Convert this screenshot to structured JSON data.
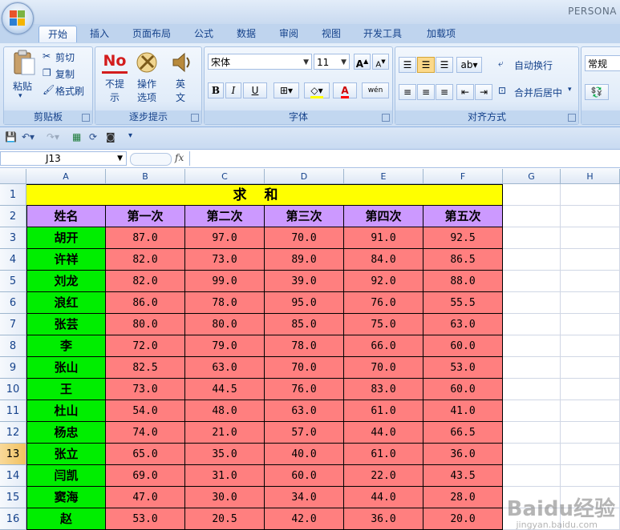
{
  "app": {
    "title": "PERSONA"
  },
  "tabs": [
    {
      "label": "开始",
      "active": true
    },
    {
      "label": "插入"
    },
    {
      "label": "页面布局"
    },
    {
      "label": "公式"
    },
    {
      "label": "数据"
    },
    {
      "label": "审阅"
    },
    {
      "label": "视图"
    },
    {
      "label": "开发工具"
    },
    {
      "label": "加载项"
    }
  ],
  "ribbon": {
    "clipboard": {
      "label": "剪贴板",
      "paste": "粘贴",
      "cut": "剪切",
      "copy": "复制",
      "format_painter": "格式刷"
    },
    "sync": {
      "label": "逐步提示",
      "no_prompt": "不提示",
      "operation_options": "操作选项",
      "english": "英文",
      "no_icon_text": "No"
    },
    "font": {
      "label": "字体",
      "font_name": "宋体",
      "font_size": "11",
      "bold": "B",
      "italic": "I",
      "underline": "U",
      "wen": "wén",
      "font_color_letter": "A"
    },
    "alignment": {
      "label": "对齐方式",
      "wrap_text": "自动换行",
      "merge_center": "合并后居中"
    },
    "number": {
      "format": "常规"
    }
  },
  "formula_bar": {
    "name_box": "J13",
    "fx": "fx",
    "formula": ""
  },
  "columns": [
    "A",
    "B",
    "C",
    "D",
    "E",
    "F",
    "G",
    "H"
  ],
  "rows": [
    "1",
    "2",
    "3",
    "4",
    "5",
    "6",
    "7",
    "8",
    "9",
    "10",
    "11",
    "12",
    "13",
    "14",
    "15",
    "16"
  ],
  "selected_row": "13",
  "sheet": {
    "title": "求和",
    "headers": [
      "姓名",
      "第一次",
      "第二次",
      "第三次",
      "第四次",
      "第五次"
    ],
    "data": [
      [
        "胡开",
        "87.0",
        "97.0",
        "70.0",
        "91.0",
        "92.5"
      ],
      [
        "许祥",
        "82.0",
        "73.0",
        "89.0",
        "84.0",
        "86.5"
      ],
      [
        "刘龙",
        "82.0",
        "99.0",
        "39.0",
        "92.0",
        "88.0"
      ],
      [
        "浪红",
        "86.0",
        "78.0",
        "95.0",
        "76.0",
        "55.5"
      ],
      [
        "张芸",
        "80.0",
        "80.0",
        "85.0",
        "75.0",
        "63.0"
      ],
      [
        "李",
        "72.0",
        "79.0",
        "78.0",
        "66.0",
        "60.0"
      ],
      [
        "张山",
        "82.5",
        "63.0",
        "70.0",
        "70.0",
        "53.0"
      ],
      [
        "王",
        "73.0",
        "44.5",
        "76.0",
        "83.0",
        "60.0"
      ],
      [
        "杜山",
        "54.0",
        "48.0",
        "63.0",
        "61.0",
        "41.0"
      ],
      [
        "杨忠",
        "74.0",
        "21.0",
        "57.0",
        "44.0",
        "66.5"
      ],
      [
        "张立",
        "65.0",
        "35.0",
        "40.0",
        "61.0",
        "36.0"
      ],
      [
        "闫凯",
        "69.0",
        "31.0",
        "60.0",
        "22.0",
        "43.5"
      ],
      [
        "窦海",
        "47.0",
        "30.0",
        "34.0",
        "44.0",
        "28.0"
      ],
      [
        "赵",
        "53.0",
        "20.5",
        "42.0",
        "36.0",
        "20.0"
      ]
    ]
  },
  "watermark": {
    "main": "Baidu经验",
    "sub": "jingyan.baidu.com"
  },
  "colors": {
    "title_bg": "#ffff00",
    "header_bg": "#cc99ff",
    "name_bg": "#00ee00",
    "value_bg": "#ff7f7f"
  }
}
